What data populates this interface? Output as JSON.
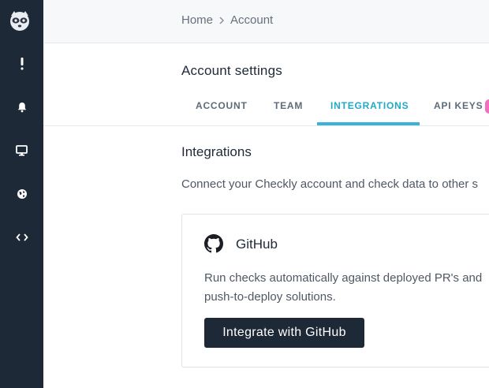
{
  "app": {
    "name": "Checkly",
    "logo_icon": "raccoon-logo-icon"
  },
  "colors": {
    "sidebar_bg": "#1e2937",
    "accent": "#21a9c9",
    "badge": "#f16fbf",
    "button_bg": "#1e2937"
  },
  "sidebar": {
    "items": [
      {
        "icon": "alert-exclamation-icon"
      },
      {
        "icon": "bell-icon"
      },
      {
        "icon": "monitor-icon"
      },
      {
        "icon": "globe-icon"
      },
      {
        "icon": "code-brackets-icon"
      }
    ]
  },
  "breadcrumb": {
    "home": "Home",
    "separator_icon": "chevron-right-icon",
    "current": "Account"
  },
  "page": {
    "title": "Account settings"
  },
  "tabs": [
    {
      "label": "ACCOUNT",
      "active": false
    },
    {
      "label": "TEAM",
      "active": false
    },
    {
      "label": "INTEGRATIONS",
      "active": true
    },
    {
      "label": "API KEYS",
      "active": false
    }
  ],
  "integrations": {
    "title": "Integrations",
    "description": "Connect your Checkly account and check data to other s",
    "card": {
      "icon": "github-icon",
      "title": "GitHub",
      "description_line1": "Run checks automatically against deployed PR's and",
      "description_line2": "push-to-deploy solutions.",
      "button_label": "Integrate with GitHub"
    }
  }
}
